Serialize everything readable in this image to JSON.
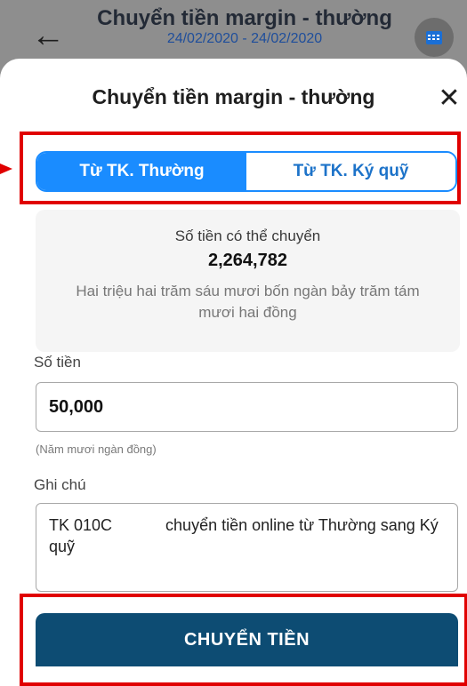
{
  "background_screen": {
    "title": "Chuyển tiền margin - thường",
    "date_range": "24/02/2020 - 24/02/2020"
  },
  "sheet": {
    "title": "Chuyển tiền margin - thường",
    "close_label": "✕"
  },
  "source_toggle": {
    "options": [
      "Từ TK. Thường",
      "Từ TK. Ký quỹ"
    ],
    "selected": "Từ TK. Thường"
  },
  "available": {
    "label": "Số tiền có thể chuyển",
    "amount": "2,264,782",
    "in_words": "Hai triệu hai trăm sáu mươi bốn ngàn bảy trăm tám mươi hai đồng"
  },
  "amount": {
    "label": "Số tiền",
    "value": "50,000",
    "in_words": "(Năm mươi ngàn đồng)"
  },
  "note": {
    "label": "Ghi chú",
    "value": "TK 010C            chuyển tiền online từ Thường sang Ký quỹ"
  },
  "submit_label": "CHUYỂN TIỀN",
  "colors": {
    "primary": "#1a8cff",
    "submit": "#0d4c73",
    "highlight": "#e00000"
  },
  "icons": {
    "back": "arrow-left-icon",
    "calendar": "calendar-icon",
    "close": "close-icon"
  }
}
